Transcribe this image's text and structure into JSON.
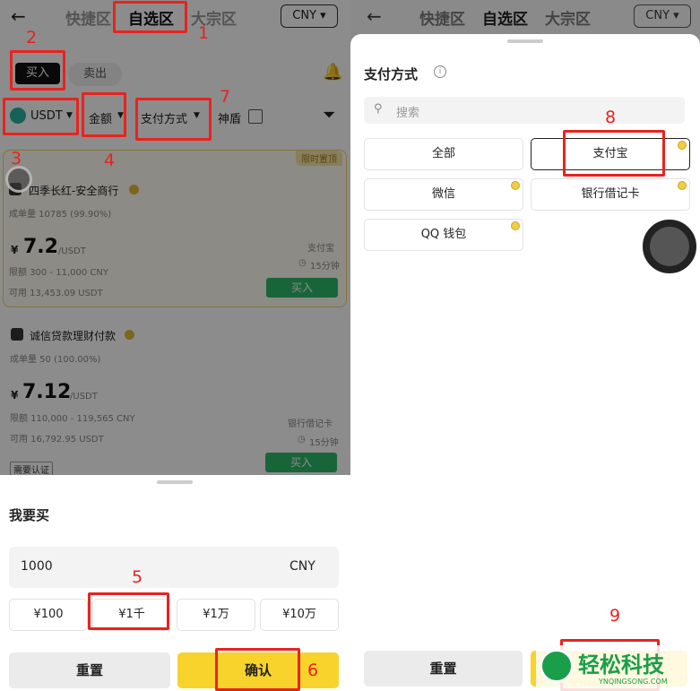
{
  "left": {
    "nav": {
      "back": "←",
      "tabs": [
        "快捷区",
        "自选区",
        "大宗区"
      ],
      "currency": "CNY ▾"
    },
    "segment": {
      "buy": "买入",
      "sell": "卖出"
    },
    "filters": {
      "coin": "USDT",
      "amount": "金额",
      "payment": "支付方式",
      "shield": "神盾"
    },
    "ads": [
      {
        "badge": "限时置顶",
        "merchant": "四季长红-安全商行",
        "volume": "成单量 10785 (99.90%)",
        "currency_sym": "¥",
        "price": "7.2",
        "unit": "/USDT",
        "limit": "限额 300 - 11,000 CNY",
        "available": "可用 13,453.09 USDT",
        "pay": "支付宝",
        "time": "15分钟",
        "action": "买入"
      },
      {
        "merchant": "诚信贷款理财付款",
        "volume": "成单量 50 (100.00%)",
        "currency_sym": "¥",
        "price": "7.12",
        "unit": "/USDT",
        "limit": "限额 110,000 - 119,565 CNY",
        "available": "可用 16,792.95 USDT",
        "pay": "银行借记卡",
        "time": "15分钟",
        "action": "买入",
        "tag": "需要认证"
      }
    ],
    "sheet": {
      "title": "我要买",
      "amount": "1000",
      "currency": "CNY",
      "quick": [
        "¥100",
        "¥1千",
        "¥1万",
        "¥10万"
      ],
      "reset": "重置",
      "confirm": "确认"
    },
    "annotations": [
      "1",
      "2",
      "3",
      "4",
      "5",
      "6",
      "7"
    ]
  },
  "right": {
    "nav": {
      "back": "←",
      "tabs": [
        "快捷区",
        "自选区",
        "大宗区"
      ],
      "currency": "CNY ▾"
    },
    "title": "支付方式",
    "search_placeholder": "搜索",
    "options": [
      "全部",
      "支付宝",
      "微信",
      "银行借记卡",
      "QQ 钱包"
    ],
    "reset": "重置",
    "annotations": [
      "8",
      "9"
    ],
    "watermark": {
      "name": "轻松科技",
      "url": "YNQINGSONG.COM"
    }
  },
  "colors": {
    "accent": "#f8d32c",
    "buy": "#2fb86b",
    "annotation": "#e8231f"
  }
}
